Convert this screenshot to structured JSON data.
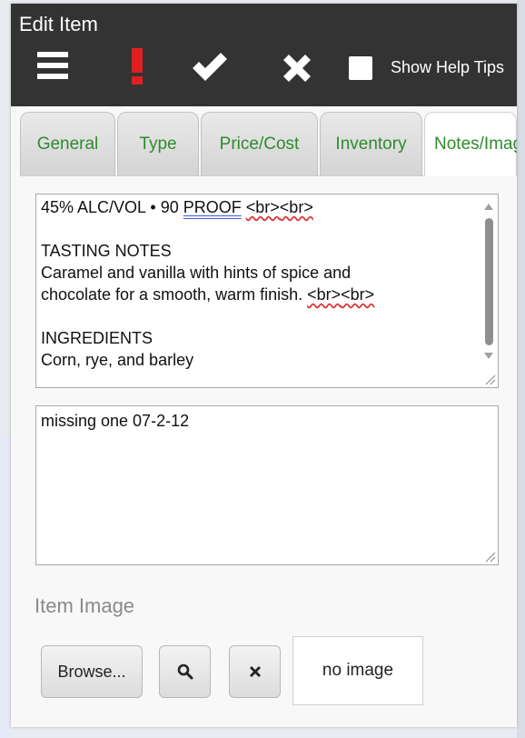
{
  "window": {
    "title": "Edit Item"
  },
  "toolbar": {
    "menu_icon": "hamburger-icon",
    "alert_icon": "exclamation-icon",
    "alert_color": "#e02020",
    "save_icon": "checkmark-icon",
    "cancel_icon": "x-icon",
    "help_tips_label": "Show Help Tips",
    "help_tips_checked": false
  },
  "tabs": [
    {
      "label": "General",
      "active": false
    },
    {
      "label": "Type",
      "active": false
    },
    {
      "label": "Price/Cost",
      "active": false
    },
    {
      "label": "Inventory",
      "active": false
    },
    {
      "label": "Notes/Images",
      "active": true
    }
  ],
  "description": {
    "line1_pre": "45% ALC/VOL • 90 ",
    "line1_proof": "PROOF",
    "br_token": "<br>",
    "heading_tasting": "TASTING NOTES",
    "tasting_line1": "Caramel and vanilla with hints of spice and",
    "tasting_line2_pre": "chocolate for a smooth, warm finish. ",
    "heading_ingredients": "INGREDIENTS",
    "ingredients_line": "Corn, rye, and barley"
  },
  "notes": {
    "value": "missing one 07-2-12"
  },
  "image_section": {
    "label": "Item Image",
    "browse_label": "Browse...",
    "search_icon": "magnifier-icon",
    "remove_icon": "x-icon",
    "placeholder": "no image"
  },
  "colors": {
    "header_bg": "#333333",
    "tab_text": "#2e8b2e"
  }
}
